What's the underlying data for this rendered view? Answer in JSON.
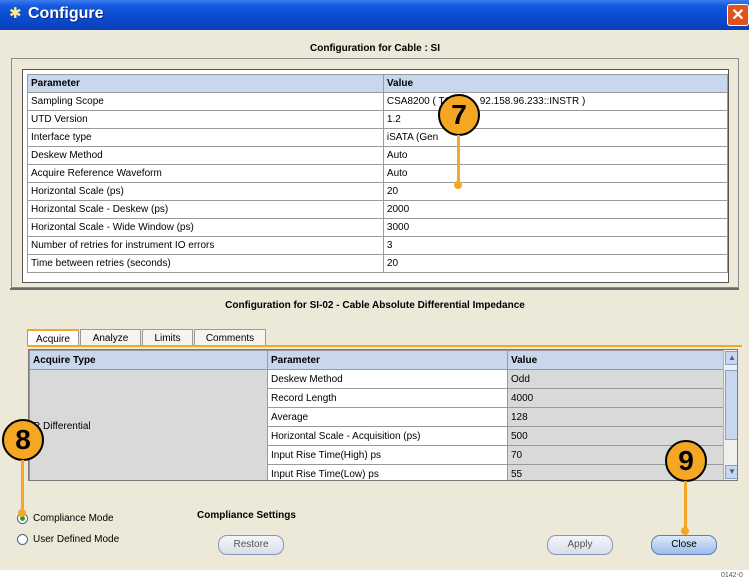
{
  "window": {
    "title": "Configure",
    "close_glyph": "✕"
  },
  "cable_section": {
    "heading": "Configuration for Cable : SI",
    "columns": [
      "Parameter",
      "Value"
    ],
    "rows": [
      [
        "Sampling Scope",
        "CSA8200 ( TC"
      ],
      [
        "UTD Version",
        "1.2"
      ],
      [
        "Interface type",
        "iSATA (Gen"
      ],
      [
        "Deskew Method",
        "Auto"
      ],
      [
        "Acquire Reference Waveform",
        "Auto"
      ],
      [
        "Horizontal Scale (ps)",
        "20"
      ],
      [
        "Horizontal Scale  - Deskew (ps)",
        "2000"
      ],
      [
        "Horizontal Scale - Wide Window (ps)",
        "3000"
      ],
      [
        "Number of retries for instrument IO errors",
        "3"
      ],
      [
        "Time between retries (seconds)",
        "20"
      ]
    ],
    "sampling_scope_tail": "92.158.96.233::INSTR )"
  },
  "measurement_section": {
    "heading": "Configuration for SI-02 - Cable Absolute Differential Impedance",
    "tabs": [
      "Acquire",
      "Analyze",
      "Limits",
      "Comments"
    ],
    "active_tab": "Acquire",
    "columns": [
      "Acquire Type",
      "Parameter",
      "Value"
    ],
    "acquire_type": "R Differential",
    "rows": [
      [
        "Deskew Method",
        "Odd"
      ],
      [
        "Record Length",
        "4000"
      ],
      [
        "Average",
        "128"
      ],
      [
        "Horizontal Scale - Acquisition (ps)",
        "500"
      ],
      [
        "Input Rise Time(High) ps",
        "70"
      ],
      [
        "Input Rise Time(Low) ps",
        "55"
      ]
    ]
  },
  "modes": {
    "compliance_label": "Compliance Mode",
    "user_defined_label": "User Defined Mode",
    "selected": "compliance",
    "settings_label": "Compliance Settings"
  },
  "buttons": {
    "restore": "Restore",
    "apply": "Apply",
    "close": "Close"
  },
  "callouts": {
    "c7": "7",
    "c8": "8",
    "c9": "9"
  },
  "figure_number": "0142-0",
  "colors": {
    "titlebar": "#0a4bd0",
    "header_row": "#c9d7ec",
    "callout": "#f5a623",
    "dialog_bg": "#ece9d8"
  }
}
